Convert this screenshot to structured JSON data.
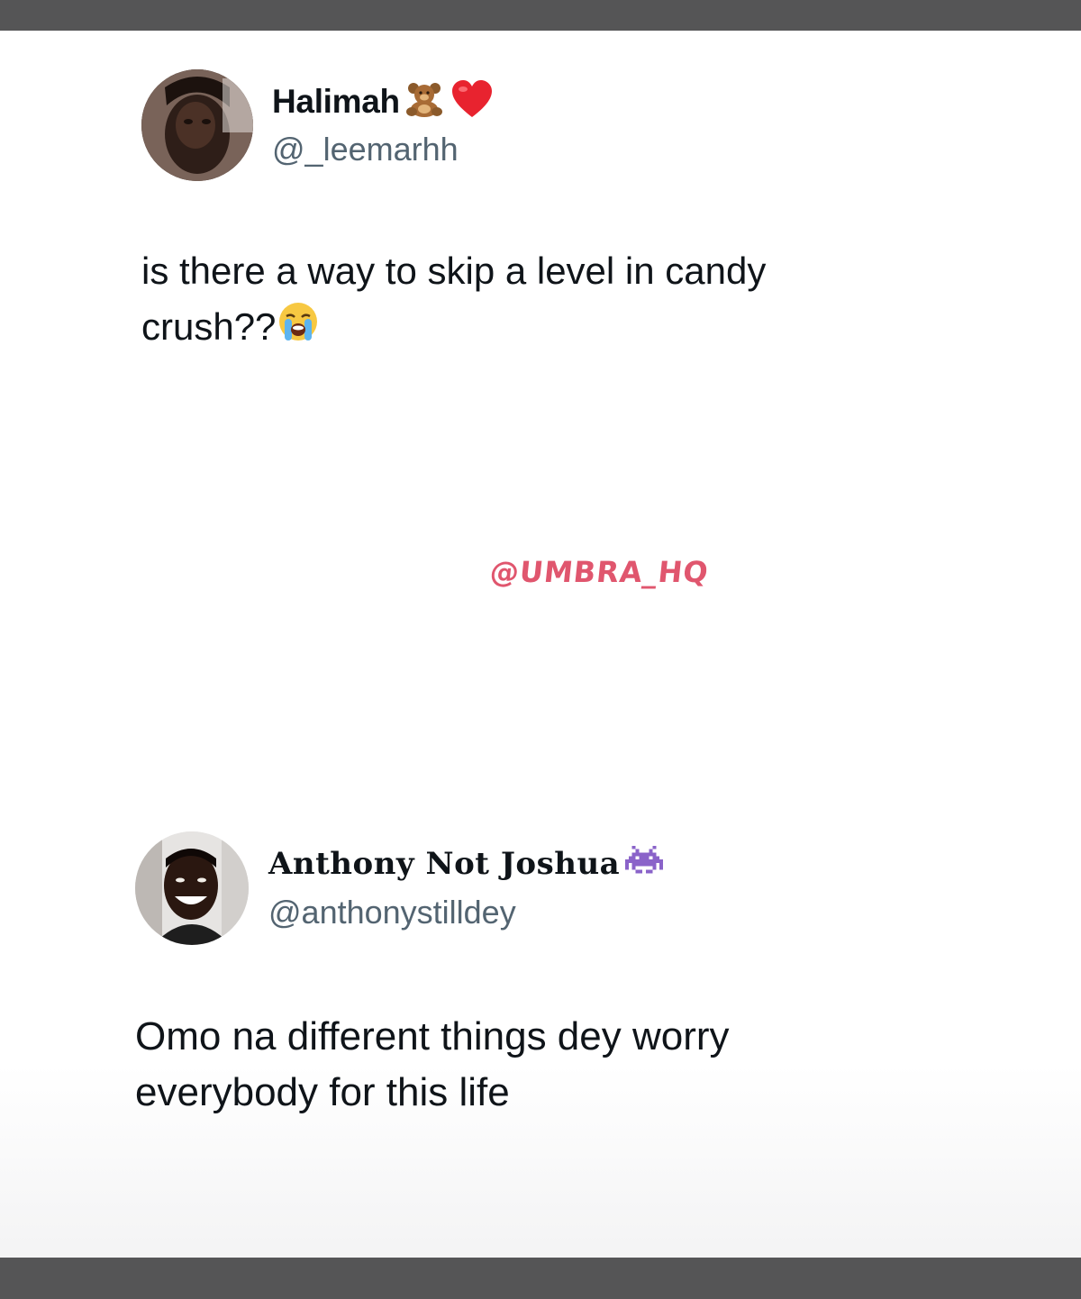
{
  "tweets": [
    {
      "display_name": "Halimah",
      "name_emojis": [
        "teddy-bear-icon",
        "red-heart-icon"
      ],
      "handle": "@_leemarhh",
      "text": "is there a way to skip a level in candy crush??",
      "text_emoji": "crying-face-icon"
    },
    {
      "display_name": "Anthony Not Joshua",
      "name_emojis": [
        "space-invader-icon"
      ],
      "handle": "@anthonystilldey",
      "text": "Omo na different things dey worry everybody for this life"
    }
  ],
  "watermark": "@UMBRA_HQ",
  "colors": {
    "frame_bar": "#555556",
    "handle": "#536471",
    "text": "#0f1419",
    "watermark": "#e0566e"
  }
}
